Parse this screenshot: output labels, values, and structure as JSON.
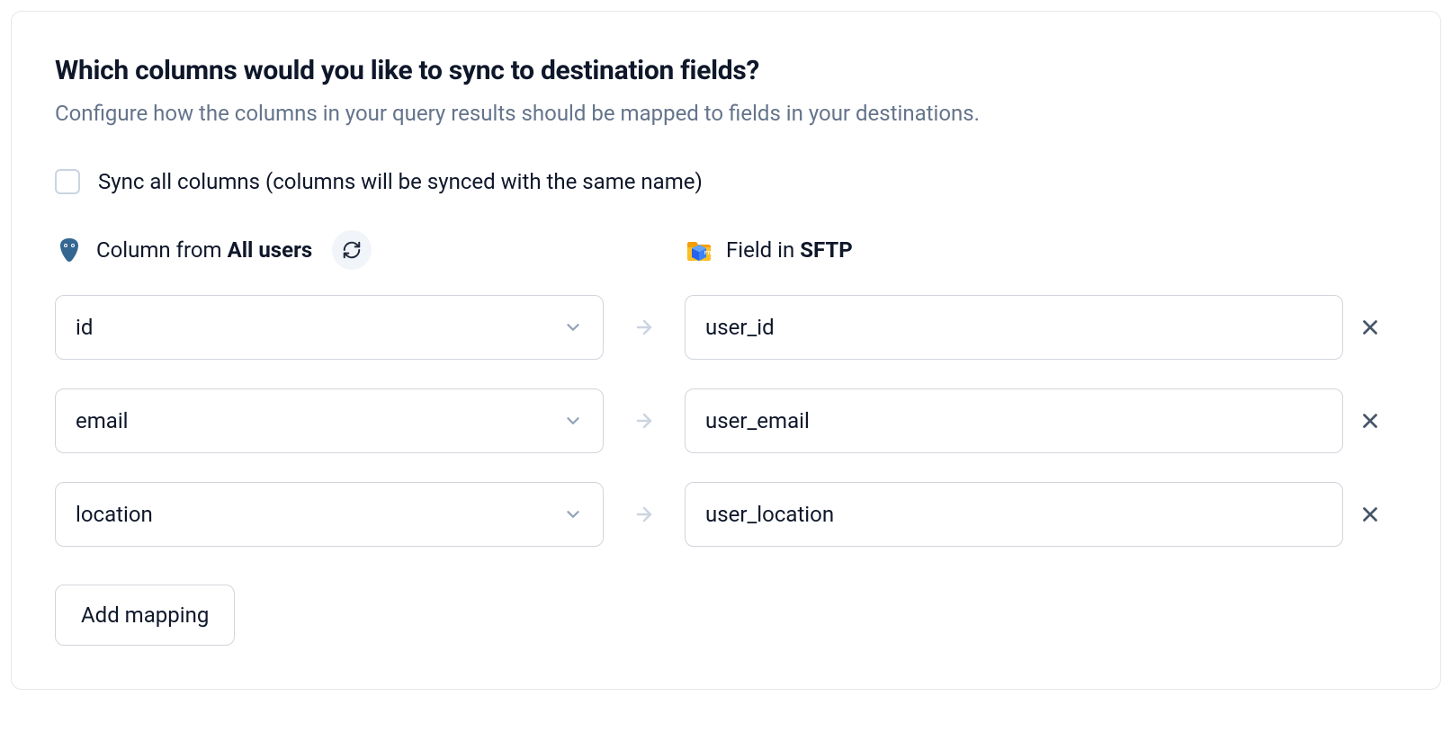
{
  "heading": "Which columns would you like to sync to destination fields?",
  "subheading": "Configure how the columns in your query results should be mapped to fields in your destinations.",
  "syncAll": {
    "label": "Sync all columns (columns will be synced with the same name)"
  },
  "sourceHeader": {
    "prefix": "Column from ",
    "name": "All users"
  },
  "destHeader": {
    "prefix": "Field in ",
    "name": "SFTP"
  },
  "mappings": [
    {
      "source": "id",
      "destination": "user_id"
    },
    {
      "source": "email",
      "destination": "user_email"
    },
    {
      "source": "location",
      "destination": "user_location"
    }
  ],
  "addButton": "Add mapping"
}
